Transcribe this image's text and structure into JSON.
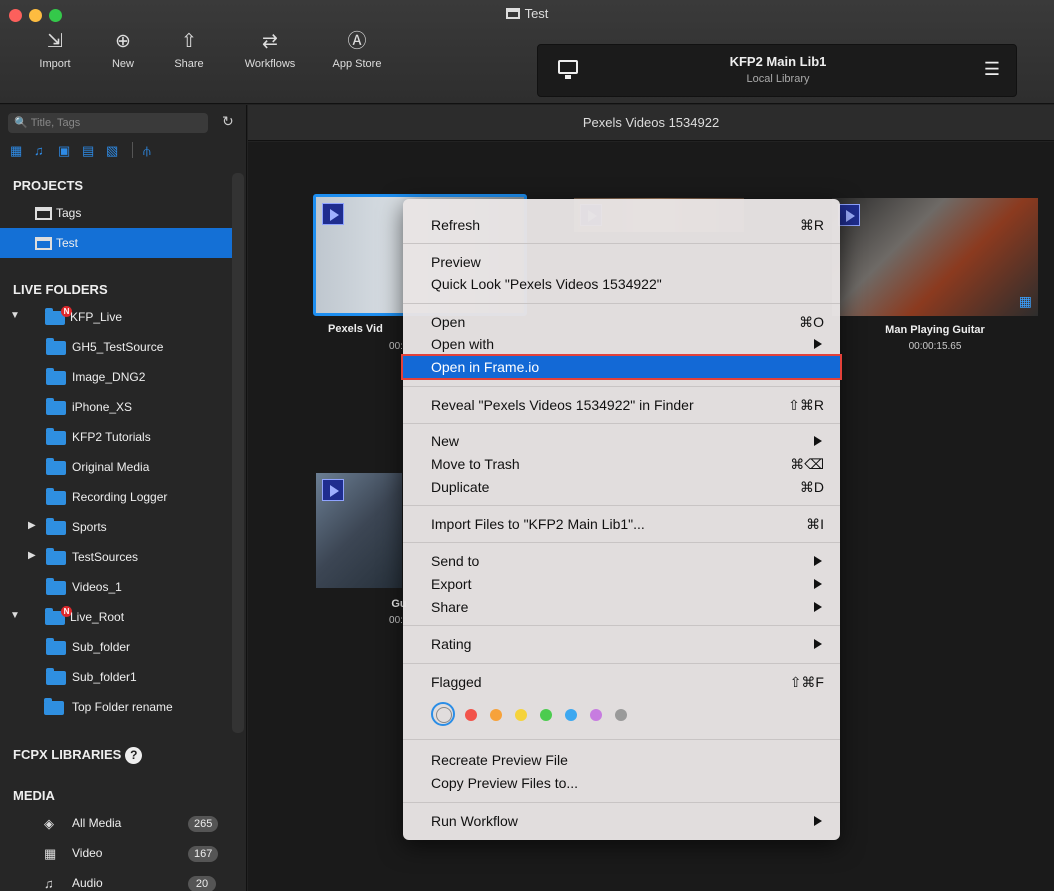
{
  "window": {
    "title": "Test"
  },
  "toolbar": {
    "import": "Import",
    "new": "New",
    "share": "Share",
    "workflows": "Workflows",
    "app_store": "App Store"
  },
  "library": {
    "name": "KFP2 Main Lib1",
    "sub": "Local Library"
  },
  "sidebar": {
    "search_placeholder": "Title, Tags",
    "projects_header": "PROJECTS",
    "projects": [
      "Tags",
      "Test"
    ],
    "live_folders_header": "LIVE FOLDERS",
    "live_folders": [
      "KFP_Live",
      "GH5_TestSource",
      "Image_DNG2",
      "iPhone_XS",
      "KFP2 Tutorials",
      "Original Media",
      "Recording Logger",
      "Sports",
      "TestSources",
      "Videos_1",
      "Live_Root",
      "Sub_folder",
      "Sub_folder1",
      "Top Folder rename"
    ],
    "badge_letter": "N",
    "fcpx_header": "FCPX LIBRARIES",
    "help_glyph": "?",
    "media_header": "MEDIA",
    "media": [
      {
        "label": "All Media",
        "count": "265"
      },
      {
        "label": "Video",
        "count": "167"
      },
      {
        "label": "Audio",
        "count": "20"
      }
    ]
  },
  "main": {
    "title": "Pexels Videos 1534922",
    "clips": [
      {
        "title": "Pexels Vid",
        "duration": "00:"
      },
      {
        "title": "Man Playing Guitar",
        "duration": "00:00:15.65"
      },
      {
        "title": "Gu",
        "duration": "00:"
      }
    ]
  },
  "menu": {
    "refresh": "Refresh",
    "refresh_key": "⌘R",
    "preview": "Preview",
    "quick_look": "Quick Look \"Pexels Videos 1534922\"",
    "open": "Open",
    "open_key": "⌘O",
    "open_with": "Open with",
    "open_frameio": "Open in Frame.io",
    "reveal": "Reveal \"Pexels Videos 1534922\" in Finder",
    "reveal_key": "⇧⌘R",
    "new": "New",
    "move_trash": "Move to Trash",
    "move_trash_key": "⌘⌫",
    "duplicate": "Duplicate",
    "duplicate_key": "⌘D",
    "import_files": "Import Files to \"KFP2 Main Lib1\"...",
    "import_key": "⌘I",
    "send_to": "Send to",
    "export": "Export",
    "share": "Share",
    "rating": "Rating",
    "flagged": "Flagged",
    "flagged_key": "⇧⌘F",
    "recreate_preview": "Recreate Preview File",
    "copy_preview": "Copy Preview Files to...",
    "run_workflow": "Run Workflow"
  },
  "colors": {
    "accent": "#1470d6",
    "labels": [
      "#f2534a",
      "#f7a23a",
      "#f5d33b",
      "#4ccc4f",
      "#3da8f0",
      "#c77ce0",
      "#9a9a9a"
    ]
  }
}
